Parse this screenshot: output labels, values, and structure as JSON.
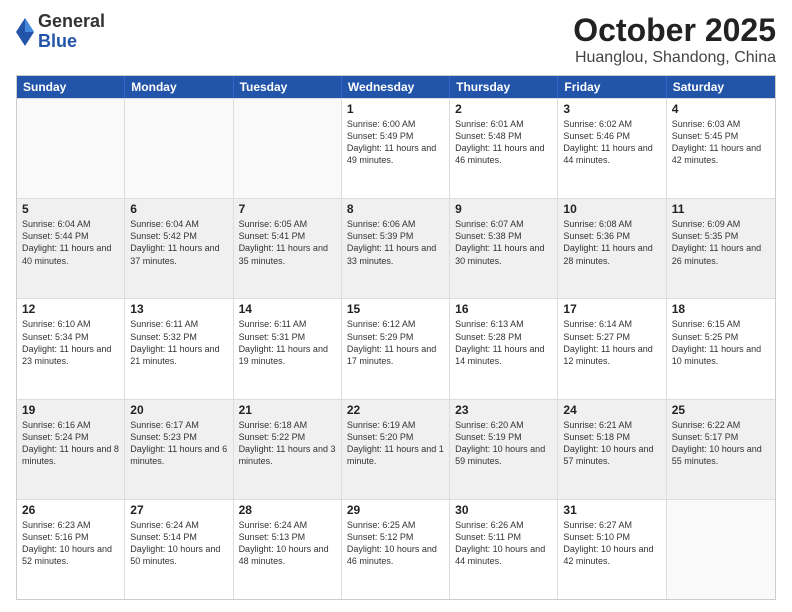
{
  "logo": {
    "general": "General",
    "blue": "Blue"
  },
  "header": {
    "month": "October 2025",
    "location": "Huanglou, Shandong, China"
  },
  "weekdays": [
    "Sunday",
    "Monday",
    "Tuesday",
    "Wednesday",
    "Thursday",
    "Friday",
    "Saturday"
  ],
  "weeks": [
    [
      {
        "day": "",
        "info": "",
        "empty": true
      },
      {
        "day": "",
        "info": "",
        "empty": true
      },
      {
        "day": "",
        "info": "",
        "empty": true
      },
      {
        "day": "1",
        "info": "Sunrise: 6:00 AM\nSunset: 5:49 PM\nDaylight: 11 hours and 49 minutes."
      },
      {
        "day": "2",
        "info": "Sunrise: 6:01 AM\nSunset: 5:48 PM\nDaylight: 11 hours and 46 minutes."
      },
      {
        "day": "3",
        "info": "Sunrise: 6:02 AM\nSunset: 5:46 PM\nDaylight: 11 hours and 44 minutes."
      },
      {
        "day": "4",
        "info": "Sunrise: 6:03 AM\nSunset: 5:45 PM\nDaylight: 11 hours and 42 minutes."
      }
    ],
    [
      {
        "day": "5",
        "info": "Sunrise: 6:04 AM\nSunset: 5:44 PM\nDaylight: 11 hours and 40 minutes."
      },
      {
        "day": "6",
        "info": "Sunrise: 6:04 AM\nSunset: 5:42 PM\nDaylight: 11 hours and 37 minutes."
      },
      {
        "day": "7",
        "info": "Sunrise: 6:05 AM\nSunset: 5:41 PM\nDaylight: 11 hours and 35 minutes."
      },
      {
        "day": "8",
        "info": "Sunrise: 6:06 AM\nSunset: 5:39 PM\nDaylight: 11 hours and 33 minutes."
      },
      {
        "day": "9",
        "info": "Sunrise: 6:07 AM\nSunset: 5:38 PM\nDaylight: 11 hours and 30 minutes."
      },
      {
        "day": "10",
        "info": "Sunrise: 6:08 AM\nSunset: 5:36 PM\nDaylight: 11 hours and 28 minutes."
      },
      {
        "day": "11",
        "info": "Sunrise: 6:09 AM\nSunset: 5:35 PM\nDaylight: 11 hours and 26 minutes."
      }
    ],
    [
      {
        "day": "12",
        "info": "Sunrise: 6:10 AM\nSunset: 5:34 PM\nDaylight: 11 hours and 23 minutes."
      },
      {
        "day": "13",
        "info": "Sunrise: 6:11 AM\nSunset: 5:32 PM\nDaylight: 11 hours and 21 minutes."
      },
      {
        "day": "14",
        "info": "Sunrise: 6:11 AM\nSunset: 5:31 PM\nDaylight: 11 hours and 19 minutes."
      },
      {
        "day": "15",
        "info": "Sunrise: 6:12 AM\nSunset: 5:29 PM\nDaylight: 11 hours and 17 minutes."
      },
      {
        "day": "16",
        "info": "Sunrise: 6:13 AM\nSunset: 5:28 PM\nDaylight: 11 hours and 14 minutes."
      },
      {
        "day": "17",
        "info": "Sunrise: 6:14 AM\nSunset: 5:27 PM\nDaylight: 11 hours and 12 minutes."
      },
      {
        "day": "18",
        "info": "Sunrise: 6:15 AM\nSunset: 5:25 PM\nDaylight: 11 hours and 10 minutes."
      }
    ],
    [
      {
        "day": "19",
        "info": "Sunrise: 6:16 AM\nSunset: 5:24 PM\nDaylight: 11 hours and 8 minutes."
      },
      {
        "day": "20",
        "info": "Sunrise: 6:17 AM\nSunset: 5:23 PM\nDaylight: 11 hours and 6 minutes."
      },
      {
        "day": "21",
        "info": "Sunrise: 6:18 AM\nSunset: 5:22 PM\nDaylight: 11 hours and 3 minutes."
      },
      {
        "day": "22",
        "info": "Sunrise: 6:19 AM\nSunset: 5:20 PM\nDaylight: 11 hours and 1 minute."
      },
      {
        "day": "23",
        "info": "Sunrise: 6:20 AM\nSunset: 5:19 PM\nDaylight: 10 hours and 59 minutes."
      },
      {
        "day": "24",
        "info": "Sunrise: 6:21 AM\nSunset: 5:18 PM\nDaylight: 10 hours and 57 minutes."
      },
      {
        "day": "25",
        "info": "Sunrise: 6:22 AM\nSunset: 5:17 PM\nDaylight: 10 hours and 55 minutes."
      }
    ],
    [
      {
        "day": "26",
        "info": "Sunrise: 6:23 AM\nSunset: 5:16 PM\nDaylight: 10 hours and 52 minutes."
      },
      {
        "day": "27",
        "info": "Sunrise: 6:24 AM\nSunset: 5:14 PM\nDaylight: 10 hours and 50 minutes."
      },
      {
        "day": "28",
        "info": "Sunrise: 6:24 AM\nSunset: 5:13 PM\nDaylight: 10 hours and 48 minutes."
      },
      {
        "day": "29",
        "info": "Sunrise: 6:25 AM\nSunset: 5:12 PM\nDaylight: 10 hours and 46 minutes."
      },
      {
        "day": "30",
        "info": "Sunrise: 6:26 AM\nSunset: 5:11 PM\nDaylight: 10 hours and 44 minutes."
      },
      {
        "day": "31",
        "info": "Sunrise: 6:27 AM\nSunset: 5:10 PM\nDaylight: 10 hours and 42 minutes."
      },
      {
        "day": "",
        "info": "",
        "empty": true
      }
    ]
  ]
}
